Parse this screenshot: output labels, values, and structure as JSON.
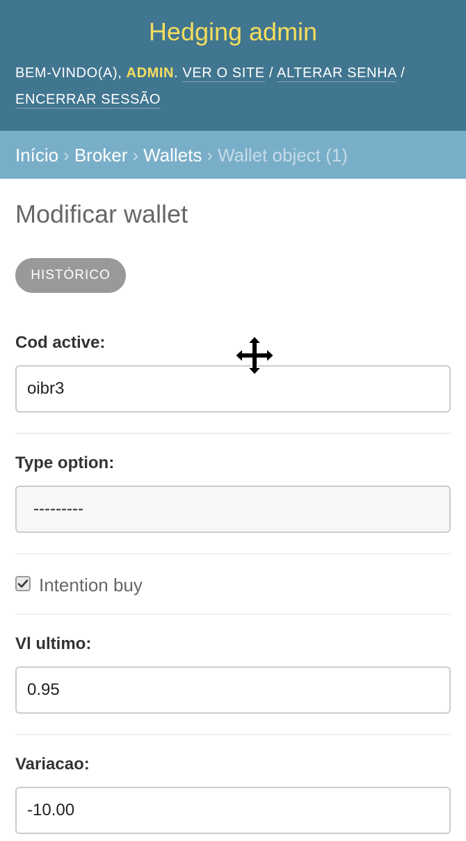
{
  "header": {
    "title": "Hedging admin",
    "welcome": "BEM-VINDO(A),",
    "username": "ADMIN",
    "links": {
      "view_site": "VER O SITE",
      "change_password": "ALTERAR SENHA",
      "logout": "ENCERRAR SESSÃO"
    },
    "colors": {
      "header_bg": "#417690",
      "brand": "#f5dd5d"
    }
  },
  "breadcrumbs": {
    "home": "Início",
    "app": "Broker",
    "model": "Wallets",
    "current": "Wallet object (1)"
  },
  "page": {
    "title": "Modificar wallet",
    "history_button": "HISTÓRICO"
  },
  "form": {
    "cod_active": {
      "label": "Cod active:",
      "value": "oibr3"
    },
    "type_option": {
      "label": "Type option:",
      "value": "---------"
    },
    "intention_buy": {
      "label": "Intention buy",
      "checked": true
    },
    "vl_ultimo": {
      "label": "Vl ultimo:",
      "value": "0.95"
    },
    "variacao": {
      "label": "Variacao:",
      "value": "-10.00"
    }
  },
  "cursor": {
    "icon": "move-cursor-icon"
  }
}
